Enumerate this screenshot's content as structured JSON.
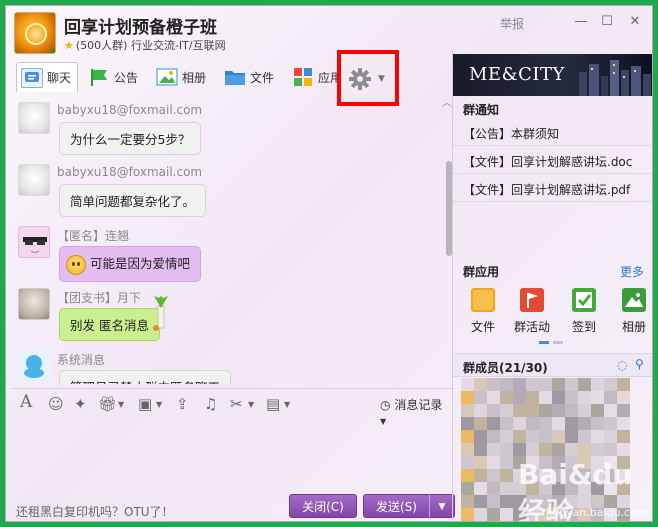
{
  "window": {
    "group_name": "回享计划预备橙子班",
    "group_meta": "(500人群) 行业交流-IT/互联网",
    "report": "举报",
    "minimize_glyph": "—",
    "maximize_glyph": "☐",
    "close_glyph": "✕"
  },
  "tabs": [
    {
      "label": "聊天",
      "icon": "chat-icon",
      "color": "#4a90d9"
    },
    {
      "label": "公告",
      "icon": "flag-icon",
      "color": "#2e9e3b"
    },
    {
      "label": "相册",
      "icon": "picture-icon",
      "color": "#3c8dd6"
    },
    {
      "label": "文件",
      "icon": "folder-icon",
      "color": "#2f86d8"
    },
    {
      "label": "应用",
      "icon": "apps-icon",
      "color": "#e94c3c"
    }
  ],
  "messages": [
    {
      "sender": "babyxu18@foxmail.com",
      "text": "为什么一定要分5步？",
      "style": "gray"
    },
    {
      "sender": "babyxu18@foxmail.com",
      "text": "简单问题都复杂化了。",
      "style": "gray"
    },
    {
      "sender": "【匿名】连翘",
      "text": "可能是因为爱情吧",
      "style": "purple"
    },
    {
      "sender": "【团支书】月下",
      "text": "别发 匿名消息",
      "style": "green"
    },
    {
      "sender": "系统消息",
      "text": "管理员已禁止群内匿名聊天",
      "style": "gray"
    }
  ],
  "toolbar": {
    "history_label": "消息记录"
  },
  "footer": {
    "ad_text": "还租黑白复印机吗？OTU了！",
    "close_label": "关闭(C)",
    "send_label": "发送(S)"
  },
  "right": {
    "banner_text": "ME&CITY",
    "notice_title": "群通知",
    "notices": [
      "【公告】本群须知",
      "【文件】回享计划解惑讲坛.doc",
      "【文件】回享计划解惑讲坛.pdf"
    ],
    "apps_title": "群应用",
    "more_label": "更多",
    "apps": [
      {
        "label": "文件",
        "color": "#f2a41c"
      },
      {
        "label": "群活动",
        "color": "#e24a32"
      },
      {
        "label": "签到",
        "color": "#4aa83a"
      },
      {
        "label": "相册",
        "color": "#3c9c3c"
      }
    ],
    "members_title": "群成员(21/30)"
  },
  "watermark": {
    "text": "Bai&du 经验",
    "sub": "jingyan.baidu.com"
  },
  "colors": {
    "accent": "#8145a8",
    "highlight_box": "#ff0000",
    "outer_background": "#1ea94a"
  }
}
